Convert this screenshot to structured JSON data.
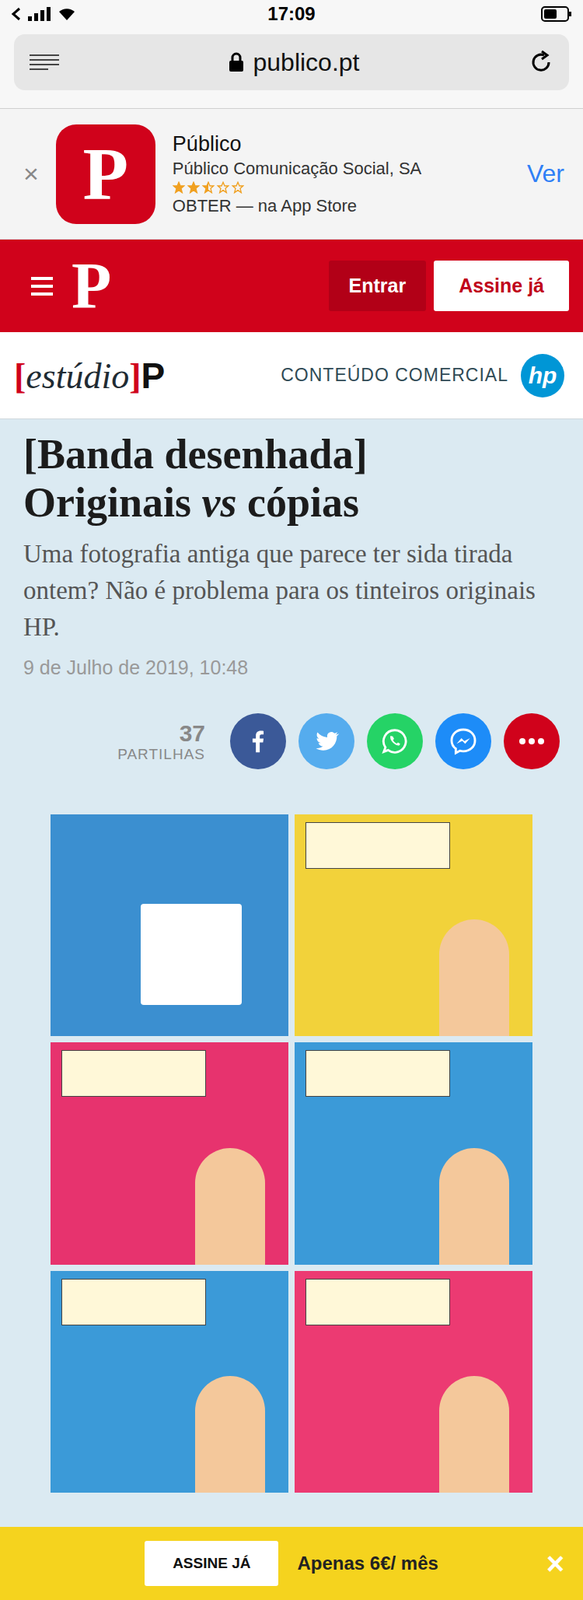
{
  "status_bar": {
    "time": "17:09"
  },
  "address_bar": {
    "url": "publico.pt"
  },
  "app_banner": {
    "close": "×",
    "logo": "P",
    "name": "Público",
    "publisher": "Público Comunicação Social, SA",
    "stars": 2.5,
    "store": "OBTER — na App Store",
    "action": "Ver"
  },
  "header": {
    "logo": "P",
    "login": "Entrar",
    "subscribe": "Assine já"
  },
  "sponsor_bar": {
    "brand_open": "[",
    "brand_word": "estúdio",
    "brand_close": "]",
    "brand_mark": "P",
    "label": "CONTEÚDO COMERCIAL",
    "sponsor_logo": "hp"
  },
  "article": {
    "kicker": "[Banda desenhada]",
    "title_parts": [
      {
        "text": "Originais ",
        "italic": false
      },
      {
        "text": "vs",
        "italic": true
      },
      {
        "text": " cópias",
        "italic": false
      }
    ],
    "subtitle": "Uma fotografia antiga que parece ter sida tirada ontem? Não é problema para os tinteiros originais HP.",
    "date": "9 de Julho de 2019, 10:48",
    "shares": {
      "count": "37",
      "label": "PARTILHAS"
    },
    "share_buttons": [
      {
        "kind": "facebook",
        "color": "#3b5998"
      },
      {
        "kind": "twitter",
        "color": "#55acee"
      },
      {
        "kind": "whatsapp",
        "color": "#25d366"
      },
      {
        "kind": "messenger",
        "color": "#1d8cf8"
      },
      {
        "kind": "more",
        "color": "#d0021b"
      }
    ]
  },
  "subscribe_bar": {
    "button": "ASSINE JÁ",
    "price": "Apenas 6€/ mês",
    "close": "×"
  }
}
